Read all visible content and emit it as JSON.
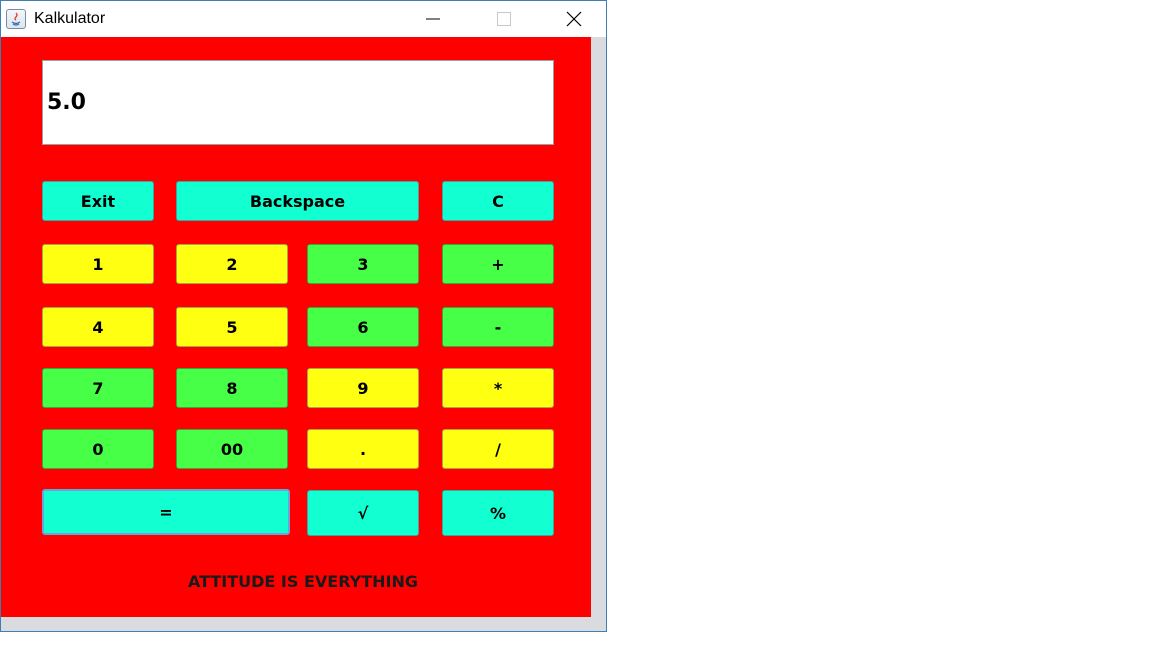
{
  "window": {
    "title": "Kalkulator",
    "controls": {
      "minimize": "minimize-icon",
      "maximize": "maximize-icon",
      "close": "close-icon"
    }
  },
  "display": {
    "value": "5.0"
  },
  "buttons": {
    "exit": "Exit",
    "backspace": "Backspace",
    "clear": "C",
    "one": "1",
    "two": "2",
    "three": "3",
    "plus": "+",
    "four": "4",
    "five": "5",
    "six": "6",
    "minus": "-",
    "seven": "7",
    "eight": "8",
    "nine": "9",
    "multiply": "*",
    "zero": "0",
    "double_zero": "00",
    "dot": ".",
    "divide": "/",
    "equals": "=",
    "sqrt": "√",
    "percent": "%"
  },
  "footer": {
    "text": "ATTITUDE IS EVERYTHING"
  },
  "colors": {
    "panel": "#ff0000",
    "cyan": "#12ffd2",
    "yellow": "#ffff12",
    "green": "#48ff48"
  }
}
